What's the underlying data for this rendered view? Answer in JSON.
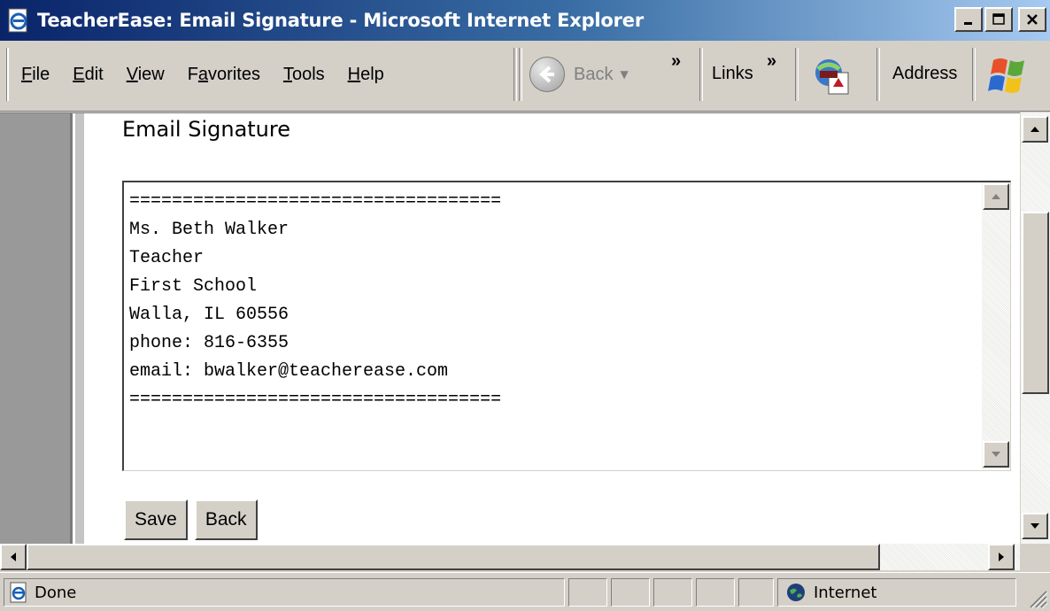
{
  "window": {
    "title": "TeacherEase: Email Signature - Microsoft Internet Explorer"
  },
  "menu": {
    "items": [
      {
        "label_u": "F",
        "label_rest": "ile"
      },
      {
        "label_u": "E",
        "label_rest": "dit"
      },
      {
        "label_u": "V",
        "label_rest": "iew"
      },
      {
        "label_pre": "F",
        "label_u": "a",
        "label_rest": "vorites"
      },
      {
        "label_u": "T",
        "label_rest": "ools"
      },
      {
        "label_u": "H",
        "label_rest": "elp"
      }
    ]
  },
  "toolbar": {
    "back_label": "Back",
    "links_label": "Links",
    "address_label": "Address",
    "chevron": "»"
  },
  "page": {
    "title": "Email Signature",
    "signature_text": "===================================\nMs. Beth Walker\nTeacher\nFirst School\nWalla, IL 60556\nphone: 816-6355\nemail: bwalker@teacherease.com\n===================================",
    "save_label": "Save",
    "back_label": "Back"
  },
  "status": {
    "text": "Done",
    "zone": "Internet"
  },
  "colors": {
    "title_gradient_start": "#0a246a",
    "title_gradient_end": "#a6caf0",
    "chrome": "#d4d0c8",
    "sidebar_dark": "#999999"
  }
}
